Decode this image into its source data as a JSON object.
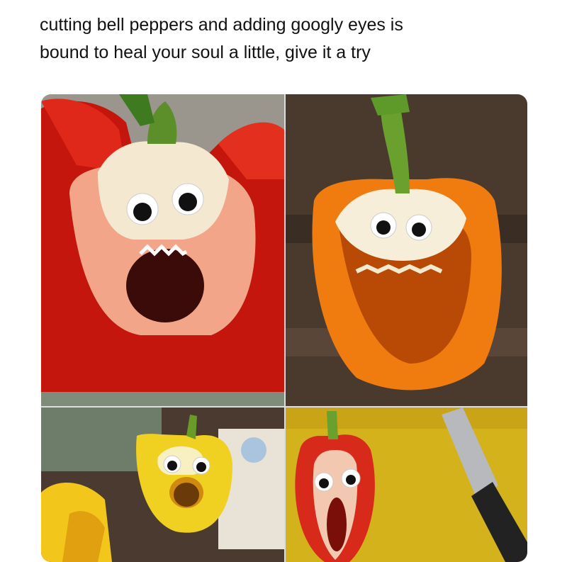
{
  "post": {
    "text_line_1": "cutting bell peppers and adding googly eyes is",
    "text_line_2": "bound to heal your soul a little, give it a try"
  },
  "media": {
    "images": [
      {
        "subject": "red-bell-pepper-googly-eyes",
        "accent": "#d81e10"
      },
      {
        "subject": "orange-bell-pepper-googly-eyes",
        "accent": "#f07c10"
      },
      {
        "subject": "yellow-bell-pepper-googly-eyes",
        "accent": "#f0d020"
      },
      {
        "subject": "red-bell-pepper-slice-googly-eyes",
        "accent": "#d82a1a"
      }
    ]
  }
}
